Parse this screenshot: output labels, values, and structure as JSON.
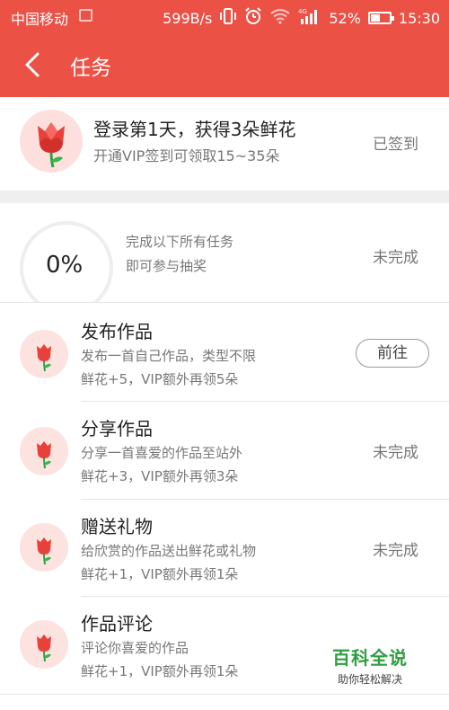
{
  "status_bar": {
    "carrier": "中国移动",
    "speed": "599B/s",
    "battery_percent": "52%",
    "battery_level": 0.52,
    "time": "15:30",
    "icons": [
      "sim-icon",
      "vibrate-icon",
      "alarm-icon",
      "wifi-icon",
      "signal-4g-icon",
      "battery-icon"
    ]
  },
  "header": {
    "title": "任务",
    "back_icon": "chevron-left-icon"
  },
  "sign_in": {
    "title": "登录第1天，获得3朵鲜花",
    "subtitle": "开通VIP签到可领取15~35朵",
    "status": "已签到",
    "icon": "rose-icon"
  },
  "lottery": {
    "progress_label": "0%",
    "progress": 0,
    "line1": "完成以下所有任务",
    "line2": "即可参与抽奖",
    "status": "未完成"
  },
  "tasks": [
    {
      "name": "发布作品",
      "desc": "发布一首自己作品，类型不限",
      "reward": "鲜花+5，VIP额外再领5朵",
      "action": "前往",
      "action_type": "button"
    },
    {
      "name": "分享作品",
      "desc": "分享一首喜爱的作品至站外",
      "reward": "鲜花+3，VIP额外再领3朵",
      "action": "未完成",
      "action_type": "status"
    },
    {
      "name": "赠送礼物",
      "desc": "给欣赏的作品送出鲜花或礼物",
      "reward": "鲜花+1，VIP额外再领1朵",
      "action": "未完成",
      "action_type": "status"
    },
    {
      "name": "作品评论",
      "desc": "评论你喜爱的作品",
      "reward": "鲜花+1，VIP额外再领1朵",
      "action": "",
      "action_type": "none"
    }
  ],
  "watermark": {
    "line1": "百科全说",
    "line2": "助你轻松解决"
  },
  "colors": {
    "brand_red": "#ec5146",
    "flower_bg": "#fde3e0",
    "watermark_green": "#2e9e3e",
    "muted_text": "#777777"
  }
}
